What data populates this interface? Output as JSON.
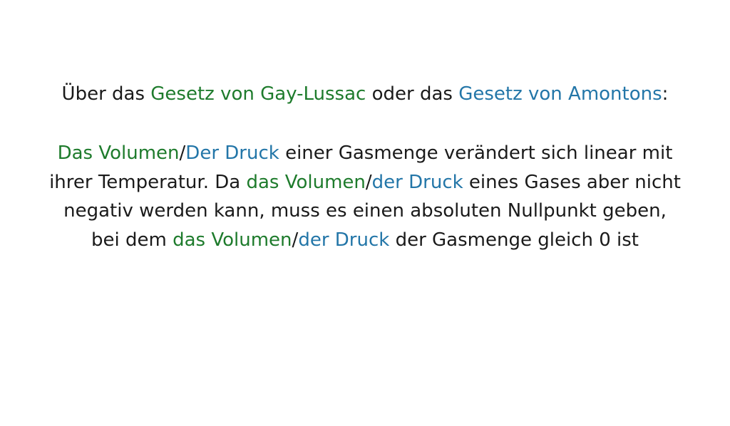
{
  "heading": {
    "prefix": "Über das ",
    "gay_lussac": "Gesetz von Gay-Lussac",
    "middle": " oder das ",
    "amontons": "Gesetz von Amontons",
    "suffix": ":"
  },
  "paragraph": {
    "line1": {
      "volumen": "Das Volumen",
      "slash": "/",
      "druck": "Der Druck",
      "rest": " einer Gasmenge verändert sich linear mit"
    },
    "line2": {
      "start": "ihrer Temperatur. Da ",
      "volumen": "das Volumen",
      "slash": "/",
      "druck": "der Druck",
      "rest": " eines Gases aber nicht"
    },
    "line3": {
      "text": "negativ werden kann, muss es einen absoluten Nullpunkt geben,"
    },
    "line4": {
      "start": "bei dem ",
      "volumen": "das Volumen",
      "slash": "/",
      "druck": "der Druck",
      "rest": " der Gasmenge gleich 0 ist"
    }
  },
  "colors": {
    "green": "#1e7b2c",
    "blue": "#2376a8",
    "text": "#1a1a1a"
  }
}
